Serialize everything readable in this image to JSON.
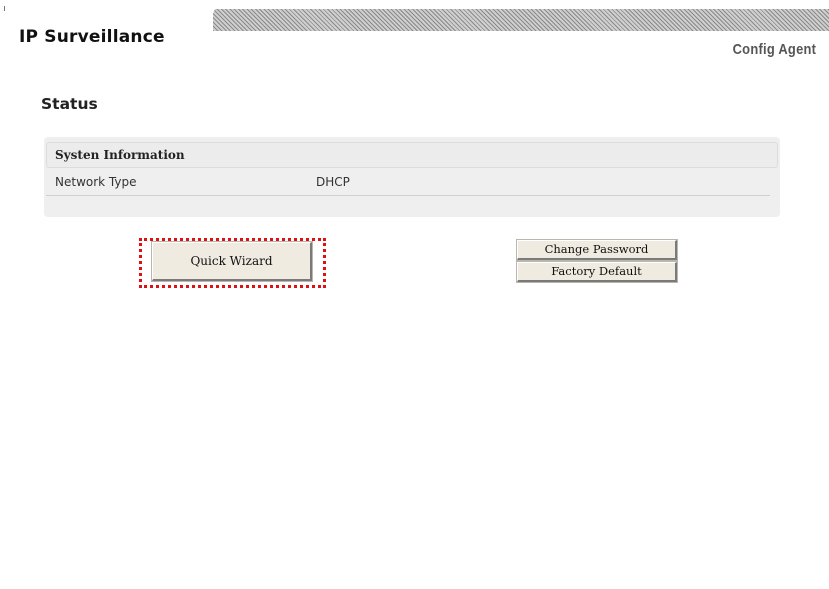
{
  "header": {
    "app_title": "IP Surveillance",
    "subtitle": "Config Agent"
  },
  "page": {
    "title": "Status"
  },
  "system_info": {
    "section_title": "Systen Information",
    "rows": [
      {
        "label": "Network Type",
        "value": "DHCP"
      }
    ]
  },
  "actions": {
    "quick_wizard": "Quick Wizard",
    "change_password": "Change Password",
    "factory_default": "Factory Default"
  },
  "colors": {
    "highlight": "#e01010",
    "button_face": "#efebe0",
    "panel_background": "#efefef"
  }
}
